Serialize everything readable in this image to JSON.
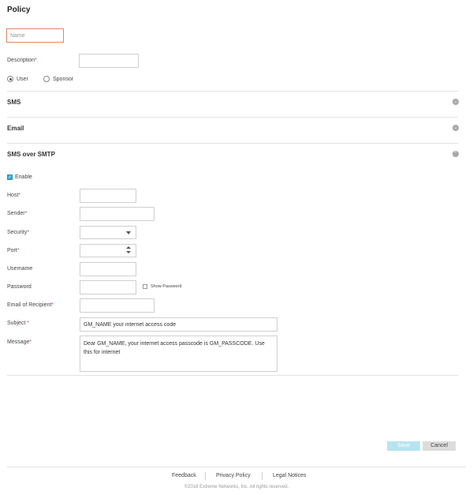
{
  "page": {
    "title": "Policy"
  },
  "form": {
    "name_placeholder": "Name",
    "description_label": "Description",
    "radio_user": "User",
    "radio_sponsor": "Sponsor",
    "required_mark": "*"
  },
  "sections": {
    "sms": "SMS",
    "email": "Email",
    "sms_over_smtp": "SMS over SMTP"
  },
  "smtp": {
    "enable_label": "Enable",
    "host_label": "Host",
    "sender_label": "Sender",
    "security_label": "Security",
    "port_label": "Port",
    "username_label": "Username",
    "password_label": "Password",
    "show_password_label": "Show Password",
    "recipient_label": "Email of Recipient",
    "subject_label": "Subject ",
    "subject_value": "GM_NAME your internet access code",
    "message_label": "Message",
    "message_value": "Dear GM_NAME, your internet access passcode is GM_PASSCODE. Use this for internet"
  },
  "actions": {
    "save": "Save",
    "cancel": "Cancel"
  },
  "footer": {
    "feedback": "Feedback",
    "privacy": "Privacy Policy",
    "legal": "Legal Notices",
    "copyright": "©2018 Extreme Networks, Inc. All rights reserved."
  },
  "colors": {
    "accent": "#2fa7d6",
    "save_button": "#b7e4f0",
    "required": "#e34a4a",
    "name_border": "#e8845f"
  }
}
